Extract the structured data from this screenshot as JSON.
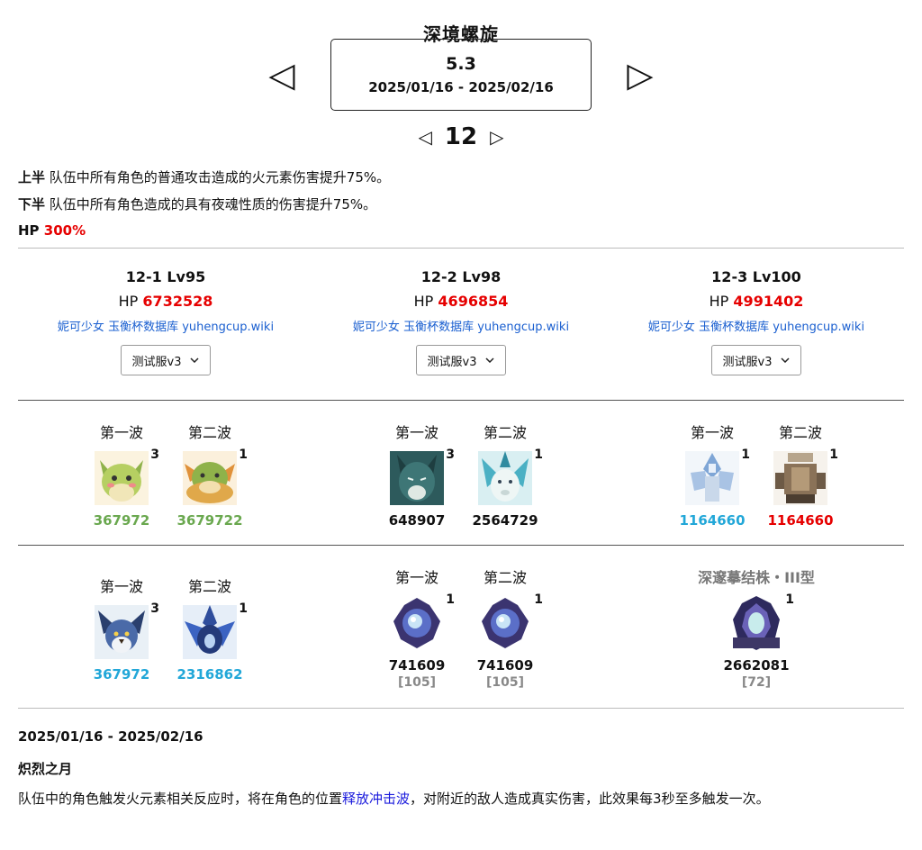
{
  "title": "深境螺旋",
  "nav": {
    "prev_version": "◁",
    "next_version": "▷",
    "prev_floor": "◁",
    "next_floor": "▷"
  },
  "version": {
    "number": "5.3",
    "date_range": "2025/01/16 - 2025/02/16"
  },
  "floor": "12",
  "buffs": {
    "first_half_label": "上半",
    "first_half_text": " 队伍中所有角色的普通攻击造成的火元素伤害提升75%。",
    "second_half_label": "下半",
    "second_half_text": " 队伍中所有角色造成的具有夜魂性质的伤害提升75%。",
    "hp_label": "HP",
    "hp_value": "300%"
  },
  "chambers": [
    {
      "title": "12-1 Lv95",
      "hp_label": "HP",
      "hp": "6732528",
      "link1": "妮可少女",
      "link2": "玉衡杯数据库",
      "link3": "yuhengcup.wiki",
      "select": "测试服v3"
    },
    {
      "title": "12-2 Lv98",
      "hp_label": "HP",
      "hp": "4696854",
      "link1": "妮可少女",
      "link2": "玉衡杯数据库",
      "link3": "yuhengcup.wiki",
      "select": "测试服v3"
    },
    {
      "title": "12-3 Lv100",
      "hp_label": "HP",
      "hp": "4991402",
      "link1": "妮可少女",
      "link2": "玉衡杯数据库",
      "link3": "yuhengcup.wiki",
      "select": "测试服v3"
    }
  ],
  "first_half": [
    {
      "waves": [
        {
          "label": "第一波",
          "icon": "green-frog-monster-icon",
          "count": "3",
          "hp": "367972",
          "hp_color": "#6aa84f"
        },
        {
          "label": "第二波",
          "icon": "green-dragon-monster-icon",
          "count": "1",
          "hp": "3679722",
          "hp_color": "#6aa84f"
        }
      ]
    },
    {
      "waves": [
        {
          "label": "第一波",
          "icon": "teal-wolf-monster-icon",
          "count": "3",
          "hp": "648907",
          "hp_color": "#111111"
        },
        {
          "label": "第二波",
          "icon": "white-lion-monster-icon",
          "count": "1",
          "hp": "2564729",
          "hp_color": "#111111"
        }
      ]
    },
    {
      "waves": [
        {
          "label": "第一波",
          "icon": "ice-construct-monster-icon",
          "count": "1",
          "hp": "1164660",
          "hp_color": "#22a7d8"
        },
        {
          "label": "第二波",
          "icon": "mech-turret-monster-icon",
          "count": "1",
          "hp": "1164660",
          "hp_color": "#e60000"
        }
      ]
    }
  ],
  "second_half": [
    {
      "waves": [
        {
          "label": "第一波",
          "icon": "blue-bird-monster-icon",
          "count": "3",
          "hp": "367972",
          "hp_color": "#22a7d8"
        },
        {
          "label": "第二波",
          "icon": "blue-crystal-beast-monster-icon",
          "count": "1",
          "hp": "2316862",
          "hp_color": "#22a7d8"
        }
      ]
    },
    {
      "waves": [
        {
          "label": "第一波",
          "icon": "purple-orb-monster-icon",
          "count": "1",
          "hp": "741609",
          "hp_color": "#111111",
          "sub": "[105]"
        },
        {
          "label": "第二波",
          "icon": "purple-orb-monster-icon",
          "count": "1",
          "hp": "741609",
          "hp_color": "#111111",
          "sub": "[105]"
        }
      ]
    },
    {
      "single_title": "深邃摹结株・III型",
      "waves": [
        {
          "label": "",
          "icon": "abyss-crystal-plant-monster-icon",
          "count": "1",
          "hp": "2662081",
          "hp_color": "#111111",
          "sub": "[72]"
        }
      ]
    }
  ],
  "footer": {
    "date_range": "2025/01/16 - 2025/02/16",
    "moon_title": "炽烈之月",
    "desc_before": "队伍中的角色触发火元素相关反应时，将在角色的位置",
    "desc_link": "释放冲击波",
    "desc_after": "，对附近的敌人造成真实伤害，此效果每3秒至多触发一次。"
  }
}
